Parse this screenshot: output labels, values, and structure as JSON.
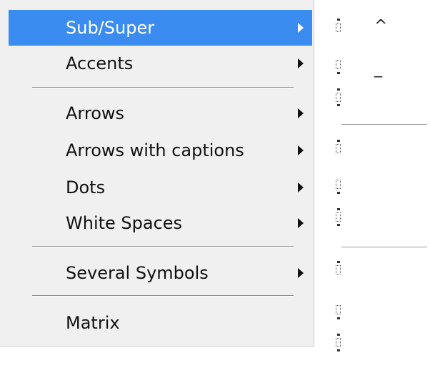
{
  "menu": {
    "items": [
      {
        "label": "Sub/Super",
        "has_submenu": true,
        "highlighted": true
      },
      {
        "label": "Accents",
        "has_submenu": true
      },
      {
        "label": "Arrows",
        "has_submenu": true
      },
      {
        "label": "Arrows with captions",
        "has_submenu": true
      },
      {
        "label": "Dots",
        "has_submenu": true
      },
      {
        "label": "White Spaces",
        "has_submenu": true
      },
      {
        "label": "Several Symbols",
        "has_submenu": true
      },
      {
        "label": "Matrix",
        "has_submenu": false
      }
    ],
    "highlight_color": "#3a8cf0"
  },
  "submenu": {
    "symbols": [
      "^",
      "_"
    ]
  }
}
